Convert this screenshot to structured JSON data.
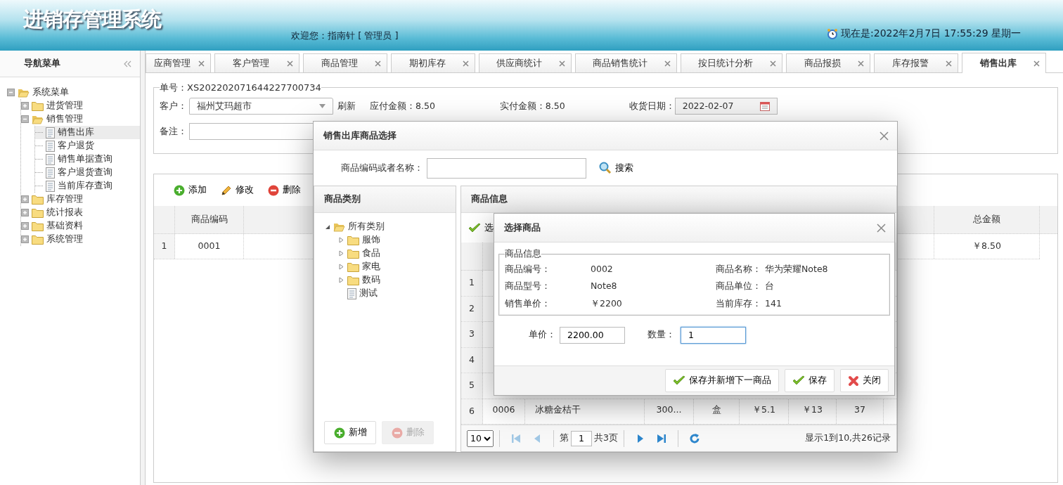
{
  "header": {
    "title": "进销存管理系统",
    "welcome": "欢迎您：指南针 [ 管理员 ]",
    "clock": "现在是:2022年2月7日 17:55:29 星期一"
  },
  "sidebar": {
    "title": "导航菜单",
    "tree": [
      {
        "label": "系统菜单",
        "kind": "folder",
        "expanded": true,
        "selected": false,
        "children": [
          {
            "label": "进货管理",
            "kind": "folder",
            "expanded": false,
            "selected": false
          },
          {
            "label": "销售管理",
            "kind": "folder",
            "expanded": true,
            "selected": false,
            "children": [
              {
                "label": "销售出库",
                "kind": "page",
                "selected": true
              },
              {
                "label": "客户退货",
                "kind": "page",
                "selected": false
              },
              {
                "label": "销售单据查询",
                "kind": "page",
                "selected": false
              },
              {
                "label": "客户退货查询",
                "kind": "page",
                "selected": false
              },
              {
                "label": "当前库存查询",
                "kind": "page",
                "selected": false
              }
            ]
          },
          {
            "label": "库存管理",
            "kind": "folder",
            "expanded": false,
            "selected": false
          },
          {
            "label": "统计报表",
            "kind": "folder",
            "expanded": false,
            "selected": false
          },
          {
            "label": "基础资料",
            "kind": "folder",
            "expanded": false,
            "selected": false
          },
          {
            "label": "系统管理",
            "kind": "folder",
            "expanded": false,
            "selected": false
          }
        ]
      }
    ]
  },
  "tabs": [
    {
      "label": "应商管理",
      "selected": false
    },
    {
      "label": "客户管理",
      "selected": false
    },
    {
      "label": "商品管理",
      "selected": false
    },
    {
      "label": "期初库存",
      "selected": false
    },
    {
      "label": "供应商统计",
      "selected": false
    },
    {
      "label": "商品销售统计",
      "selected": false
    },
    {
      "label": "按日统计分析",
      "selected": false
    },
    {
      "label": "商品报损",
      "selected": false
    },
    {
      "label": "库存报警",
      "selected": false
    },
    {
      "label": "销售出库",
      "selected": true
    }
  ],
  "order": {
    "number": "单号：XS202202071644227700734",
    "customer_label": "客户：",
    "customer": "福州艾玛超市",
    "refresh": "刷新",
    "payable": "应付金额：8.50",
    "paid": "实付金额：8.50",
    "date_label": "收货日期：",
    "date": "2022-02-07",
    "remark_label": "备注："
  },
  "toolbar": [
    {
      "label": "添加",
      "kind": "add"
    },
    {
      "label": "修改",
      "kind": "edit"
    },
    {
      "label": "删除",
      "kind": "delete"
    }
  ],
  "grid": {
    "code_column": "商品编码",
    "total_column": "总金额",
    "rows": [
      {
        "index": "1",
        "code": "0001",
        "total": "￥8.50"
      }
    ]
  },
  "dialog": {
    "title": "销售出库商品选择",
    "search_label": "商品编码或者名称：",
    "search_button": "搜索",
    "category_title": "商品类别",
    "category_tree": [
      {
        "label": "所有类别",
        "kind": "folder",
        "expanded": true,
        "children": [
          {
            "label": "服饰",
            "kind": "folder",
            "expanded": false
          },
          {
            "label": "食品",
            "kind": "folder",
            "expanded": false
          },
          {
            "label": "家电",
            "kind": "folder",
            "expanded": false
          },
          {
            "label": "数码",
            "kind": "folder",
            "expanded": false
          },
          {
            "label": "测试",
            "kind": "page"
          }
        ]
      }
    ],
    "category_buttons": [
      {
        "label": "新增",
        "kind": "add",
        "disabled": false
      },
      {
        "label": "删除",
        "kind": "delete",
        "disabled": true
      }
    ],
    "goods_title": "商品信息",
    "goods_button": "选",
    "goods_rows": [
      {
        "index": "1"
      },
      {
        "index": "2"
      },
      {
        "index": "3"
      },
      {
        "index": "4"
      },
      {
        "index": "5"
      },
      {
        "index": "6",
        "cells": [
          "0006",
          "冰糖金桔干",
          "300...",
          "盒",
          "￥5.1",
          "￥13",
          "37"
        ]
      }
    ],
    "pager": {
      "page_size": "10",
      "page_prefix": "第",
      "page": "1",
      "page_suffix": "共3页",
      "summary": "显示1到10,共26记录"
    }
  },
  "inner_dialog": {
    "title": "选择商品",
    "legend": "商品信息",
    "fields": [
      {
        "label": "商品编号：",
        "value": "0002"
      },
      {
        "label": "商品名称：",
        "value": "华为荣耀Note8"
      },
      {
        "label": "商品型号：",
        "value": "Note8"
      },
      {
        "label": "商品单位：",
        "value": "台"
      },
      {
        "label": "销售单价：",
        "value": "￥2200"
      },
      {
        "label": "当前库存：",
        "value": "141"
      }
    ],
    "price_label": "单价：",
    "price": "2200.00",
    "qty_label": "数量：",
    "qty": "1",
    "buttons": [
      {
        "label": "保存并新增下一商品",
        "kind": "save"
      },
      {
        "label": "保存",
        "kind": "save"
      },
      {
        "label": "关闭",
        "kind": "close"
      }
    ]
  }
}
